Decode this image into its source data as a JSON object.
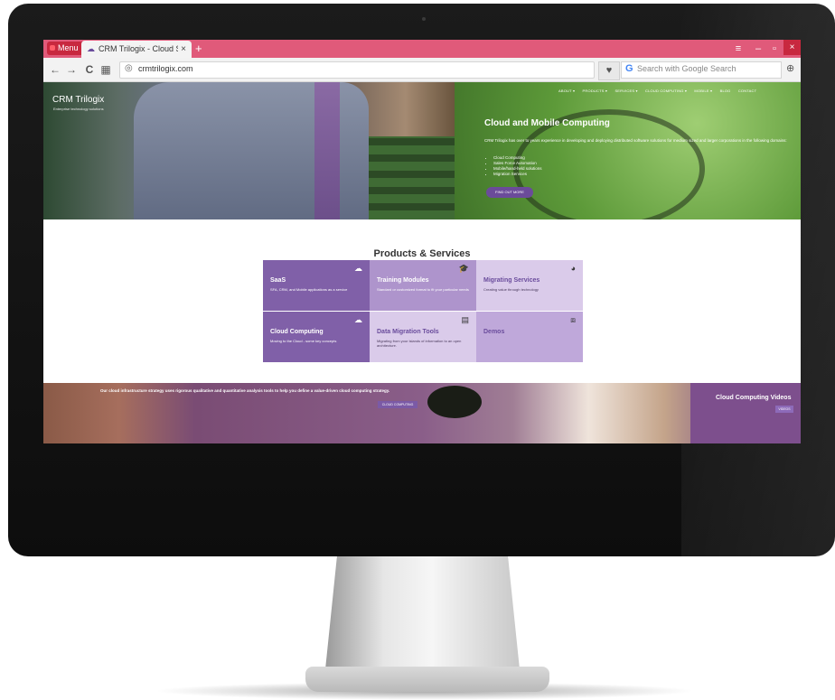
{
  "browser": {
    "menu_label": "Menu",
    "tab_title": "CRM Trilogix - Cloud Solu",
    "new_tab": "+",
    "url": "crmtrilogix.com",
    "search_placeholder": "Search with Google Search",
    "search_engine": "G",
    "window_controls": {
      "minimize": "–",
      "maximize": "▫",
      "close": "×"
    }
  },
  "site": {
    "logo": "CRM Trilogix",
    "tagline": "Enterprise technology solutions",
    "nav": [
      "ABOUT ▾",
      "PRODUCTS ▾",
      "SERVICES ▾",
      "CLOUD COMPUTING ▾",
      "MOBILE ▾",
      "BLOG",
      "CONTACT"
    ]
  },
  "hero": {
    "title": "Cloud and Mobile Computing",
    "text": "CRM Trilogix has over to years experience in developing and deploying distributed software solutions for medium sized and larger corporations in the following domains:",
    "bullets": [
      "Cloud Computing",
      "Sales Force Automation",
      "Mobile/hand-held solutions",
      "Migration Services"
    ],
    "button": "FIND OUT MORE"
  },
  "products": {
    "title": "Products & Services",
    "cards": [
      {
        "title": "SaaS",
        "desc": "SFA, CRM, and Mobile applications as a service",
        "icon": "cloud-icon"
      },
      {
        "title": "Training Modules",
        "desc": "Standard or customized format to fit your particular needs",
        "icon": "graduation-cap-icon"
      },
      {
        "title": "Migrating Services",
        "desc": "Creating value through technology",
        "icon": "pie-chart-icon"
      },
      {
        "title": "Cloud Computing",
        "desc": "Moving to the Cloud - some key concepts",
        "icon": "cloud-icon"
      },
      {
        "title": "Data Migration Tools",
        "desc": "Migrating from your islands of information to an open architecture.",
        "icon": "database-icon"
      },
      {
        "title": "Demos",
        "desc": "",
        "icon": "play-icon"
      }
    ]
  },
  "strip": {
    "text": "Our cloud infrastructure strategy uses rigorous qualitative and quantitative analysis tools to help you define a value-driven cloud computing strategy.",
    "button": "CLOUD COMPUTING",
    "videos_title": "Cloud Computing Videos",
    "videos_button": "VIDEOS"
  },
  "colors": {
    "tab_bar": "#e05a7a",
    "accent_purple": "#8060a8",
    "light_purple": "#dacbea",
    "hero_green": "#5d9a39"
  }
}
